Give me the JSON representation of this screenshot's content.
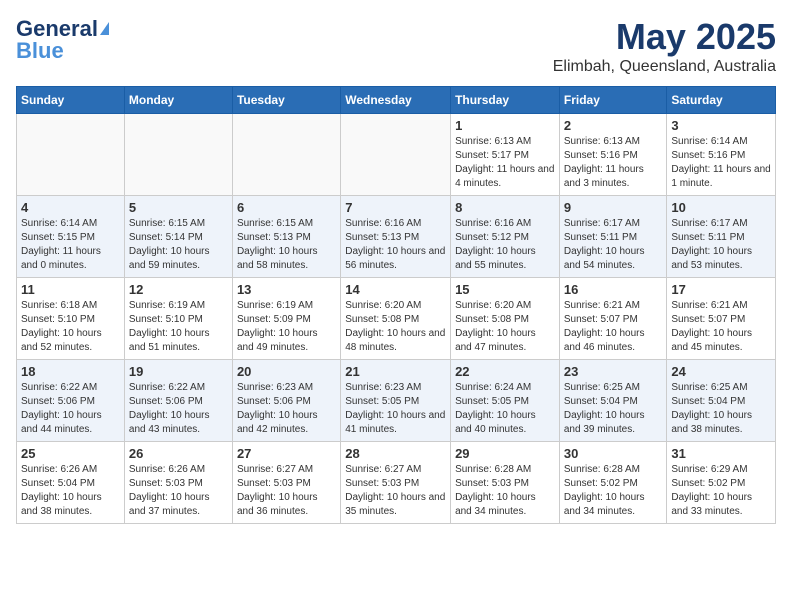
{
  "header": {
    "logo_line1": "General",
    "logo_line2": "Blue",
    "title": "May 2025",
    "subtitle": "Elimbah, Queensland, Australia"
  },
  "days_of_week": [
    "Sunday",
    "Monday",
    "Tuesday",
    "Wednesday",
    "Thursday",
    "Friday",
    "Saturday"
  ],
  "weeks": [
    [
      {
        "day": "",
        "info": ""
      },
      {
        "day": "",
        "info": ""
      },
      {
        "day": "",
        "info": ""
      },
      {
        "day": "",
        "info": ""
      },
      {
        "day": "1",
        "info": "Sunrise: 6:13 AM\nSunset: 5:17 PM\nDaylight: 11 hours and 4 minutes."
      },
      {
        "day": "2",
        "info": "Sunrise: 6:13 AM\nSunset: 5:16 PM\nDaylight: 11 hours and 3 minutes."
      },
      {
        "day": "3",
        "info": "Sunrise: 6:14 AM\nSunset: 5:16 PM\nDaylight: 11 hours and 1 minute."
      }
    ],
    [
      {
        "day": "4",
        "info": "Sunrise: 6:14 AM\nSunset: 5:15 PM\nDaylight: 11 hours and 0 minutes."
      },
      {
        "day": "5",
        "info": "Sunrise: 6:15 AM\nSunset: 5:14 PM\nDaylight: 10 hours and 59 minutes."
      },
      {
        "day": "6",
        "info": "Sunrise: 6:15 AM\nSunset: 5:13 PM\nDaylight: 10 hours and 58 minutes."
      },
      {
        "day": "7",
        "info": "Sunrise: 6:16 AM\nSunset: 5:13 PM\nDaylight: 10 hours and 56 minutes."
      },
      {
        "day": "8",
        "info": "Sunrise: 6:16 AM\nSunset: 5:12 PM\nDaylight: 10 hours and 55 minutes."
      },
      {
        "day": "9",
        "info": "Sunrise: 6:17 AM\nSunset: 5:11 PM\nDaylight: 10 hours and 54 minutes."
      },
      {
        "day": "10",
        "info": "Sunrise: 6:17 AM\nSunset: 5:11 PM\nDaylight: 10 hours and 53 minutes."
      }
    ],
    [
      {
        "day": "11",
        "info": "Sunrise: 6:18 AM\nSunset: 5:10 PM\nDaylight: 10 hours and 52 minutes."
      },
      {
        "day": "12",
        "info": "Sunrise: 6:19 AM\nSunset: 5:10 PM\nDaylight: 10 hours and 51 minutes."
      },
      {
        "day": "13",
        "info": "Sunrise: 6:19 AM\nSunset: 5:09 PM\nDaylight: 10 hours and 49 minutes."
      },
      {
        "day": "14",
        "info": "Sunrise: 6:20 AM\nSunset: 5:08 PM\nDaylight: 10 hours and 48 minutes."
      },
      {
        "day": "15",
        "info": "Sunrise: 6:20 AM\nSunset: 5:08 PM\nDaylight: 10 hours and 47 minutes."
      },
      {
        "day": "16",
        "info": "Sunrise: 6:21 AM\nSunset: 5:07 PM\nDaylight: 10 hours and 46 minutes."
      },
      {
        "day": "17",
        "info": "Sunrise: 6:21 AM\nSunset: 5:07 PM\nDaylight: 10 hours and 45 minutes."
      }
    ],
    [
      {
        "day": "18",
        "info": "Sunrise: 6:22 AM\nSunset: 5:06 PM\nDaylight: 10 hours and 44 minutes."
      },
      {
        "day": "19",
        "info": "Sunrise: 6:22 AM\nSunset: 5:06 PM\nDaylight: 10 hours and 43 minutes."
      },
      {
        "day": "20",
        "info": "Sunrise: 6:23 AM\nSunset: 5:06 PM\nDaylight: 10 hours and 42 minutes."
      },
      {
        "day": "21",
        "info": "Sunrise: 6:23 AM\nSunset: 5:05 PM\nDaylight: 10 hours and 41 minutes."
      },
      {
        "day": "22",
        "info": "Sunrise: 6:24 AM\nSunset: 5:05 PM\nDaylight: 10 hours and 40 minutes."
      },
      {
        "day": "23",
        "info": "Sunrise: 6:25 AM\nSunset: 5:04 PM\nDaylight: 10 hours and 39 minutes."
      },
      {
        "day": "24",
        "info": "Sunrise: 6:25 AM\nSunset: 5:04 PM\nDaylight: 10 hours and 38 minutes."
      }
    ],
    [
      {
        "day": "25",
        "info": "Sunrise: 6:26 AM\nSunset: 5:04 PM\nDaylight: 10 hours and 38 minutes."
      },
      {
        "day": "26",
        "info": "Sunrise: 6:26 AM\nSunset: 5:03 PM\nDaylight: 10 hours and 37 minutes."
      },
      {
        "day": "27",
        "info": "Sunrise: 6:27 AM\nSunset: 5:03 PM\nDaylight: 10 hours and 36 minutes."
      },
      {
        "day": "28",
        "info": "Sunrise: 6:27 AM\nSunset: 5:03 PM\nDaylight: 10 hours and 35 minutes."
      },
      {
        "day": "29",
        "info": "Sunrise: 6:28 AM\nSunset: 5:03 PM\nDaylight: 10 hours and 34 minutes."
      },
      {
        "day": "30",
        "info": "Sunrise: 6:28 AM\nSunset: 5:02 PM\nDaylight: 10 hours and 34 minutes."
      },
      {
        "day": "31",
        "info": "Sunrise: 6:29 AM\nSunset: 5:02 PM\nDaylight: 10 hours and 33 minutes."
      }
    ]
  ]
}
